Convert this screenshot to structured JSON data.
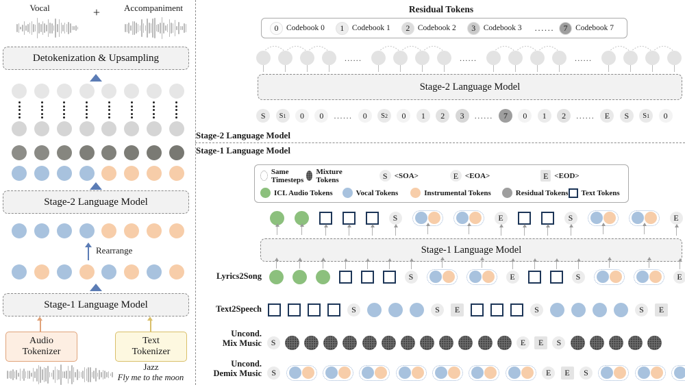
{
  "figure": {
    "left_panel": {
      "top_labels": {
        "vocal": "Vocal",
        "plus": "+",
        "accompaniment": "Accompaniment"
      },
      "detokenization_box": "Detokenization & Upsampling",
      "stage2_box": "Stage-2 Language Model",
      "rearrange_label": "Rearrange",
      "stage1_box": "Stage-1 Language Model",
      "audio_tokenizer": "Audio\nTokenizer",
      "audio_tokenizer_l1": "Audio",
      "audio_tokenizer_l2": "Tokenizer",
      "text_tokenizer_l1": "Text",
      "text_tokenizer_l2": "Tokenizer",
      "text_prompt_genre": "Jazz",
      "text_prompt_lyrics": "Fly me to the moon",
      "token_grid_columns": 8,
      "bottom_row_colors": [
        "vocal",
        "vocal",
        "vocal",
        "vocal",
        "inst",
        "inst",
        "inst",
        "inst"
      ],
      "rearrange_in_colors": [
        "vocal",
        "inst",
        "vocal",
        "inst",
        "vocal",
        "inst",
        "vocal",
        "inst"
      ],
      "rearrange_out_colors": [
        "vocal",
        "vocal",
        "vocal",
        "vocal",
        "inst",
        "inst",
        "inst",
        "inst"
      ]
    },
    "right_panel": {
      "residual_title": "Residual Tokens",
      "codebooks": [
        {
          "id": "0",
          "label": "Codebook 0",
          "shade": "#fbfbfb"
        },
        {
          "id": "1",
          "label": "Codebook 1",
          "shade": "#ededed"
        },
        {
          "id": "2",
          "label": "Codebook 2",
          "shade": "#dcdcdc"
        },
        {
          "id": "3",
          "label": "Codebook 3",
          "shade": "#cacaca"
        },
        {
          "id": "7",
          "label": "Codebook 7",
          "shade": "#9e9e9e"
        }
      ],
      "codebook_ellipsis": "......",
      "stage2_model_box": "Stage-2 Language Model",
      "stage2_input_tokens": [
        {
          "t": "S",
          "k": "sym"
        },
        {
          "t": "S₁",
          "k": "sym"
        },
        {
          "t": "0",
          "k": "cb0"
        },
        {
          "t": "0",
          "k": "cb0"
        },
        {
          "t": "......",
          "k": "dots"
        },
        {
          "t": "0",
          "k": "cb0"
        },
        {
          "t": "S₂",
          "k": "sym"
        },
        {
          "t": "0",
          "k": "cb0"
        },
        {
          "t": "1",
          "k": "cb1"
        },
        {
          "t": "2",
          "k": "cb2"
        },
        {
          "t": "3",
          "k": "cb3"
        },
        {
          "t": "......",
          "k": "dots"
        },
        {
          "t": "7",
          "k": "cb7"
        },
        {
          "t": "0",
          "k": "cb0"
        },
        {
          "t": "1",
          "k": "cb1"
        },
        {
          "t": "2",
          "k": "cb2"
        },
        {
          "t": "......",
          "k": "dots"
        },
        {
          "t": "E",
          "k": "sym"
        },
        {
          "t": "S",
          "k": "sym"
        },
        {
          "t": "S₁",
          "k": "sym"
        },
        {
          "t": "0",
          "k": "cb0"
        }
      ],
      "section_label_stage2": "Stage-2 Language Model",
      "section_label_stage1": "Stage-1 Language Model",
      "legend_row1": [
        {
          "name": "same-timesteps",
          "label": "Same Timesteps",
          "glyph": "dotted-circle"
        },
        {
          "name": "mixture-tokens",
          "label": "Mixture Tokens",
          "glyph": "textured-circle"
        },
        {
          "name": "soa",
          "label": "<SOA>",
          "glyph": "S"
        },
        {
          "name": "eoa",
          "label": "<EOA>",
          "glyph": "E-circle"
        },
        {
          "name": "eod",
          "label": "<EOD>",
          "glyph": "E-square"
        }
      ],
      "legend_row2": [
        {
          "name": "icl-audio-tokens",
          "label": "ICL Audio Tokens",
          "color": "#8cc07d"
        },
        {
          "name": "vocal-tokens",
          "label": "Vocal Tokens",
          "color": "#a8c2de"
        },
        {
          "name": "instrumental-tokens",
          "label": "Instrumental Tokens",
          "color": "#f7cda9"
        },
        {
          "name": "residual-tokens",
          "label": "Residual Tokens",
          "color": "#9e9e9e"
        },
        {
          "name": "text-tokens",
          "label": "Text Tokens",
          "color": "#ffffff"
        }
      ],
      "stage1_model_box": "Stage-1 Language Model",
      "stage1_output_tokens": [
        {
          "k": "icl"
        },
        {
          "k": "icl"
        },
        {
          "k": "text"
        },
        {
          "k": "text"
        },
        {
          "k": "text"
        },
        {
          "k": "S"
        },
        {
          "k": "pair"
        },
        {
          "k": "pair"
        },
        {
          "k": "E"
        },
        {
          "k": "text"
        },
        {
          "k": "text"
        },
        {
          "k": "S"
        },
        {
          "k": "pair"
        },
        {
          "k": "pair"
        },
        {
          "k": "E"
        },
        {
          "k": "EOD"
        }
      ],
      "rows": [
        {
          "name": "lyrics2song",
          "label": "Lyrics2Song",
          "tokens": [
            {
              "k": "icl"
            },
            {
              "k": "icl"
            },
            {
              "k": "icl"
            },
            {
              "k": "text"
            },
            {
              "k": "text"
            },
            {
              "k": "text"
            },
            {
              "k": "S"
            },
            {
              "k": "pair"
            },
            {
              "k": "pair"
            },
            {
              "k": "E"
            },
            {
              "k": "text"
            },
            {
              "k": "text"
            },
            {
              "k": "S"
            },
            {
              "k": "pair"
            },
            {
              "k": "pair"
            },
            {
              "k": "E"
            },
            {
              "k": "EOD"
            }
          ]
        },
        {
          "name": "text2speech",
          "label": "Text2Speech",
          "tokens": [
            {
              "k": "text"
            },
            {
              "k": "text"
            },
            {
              "k": "text"
            },
            {
              "k": "text"
            },
            {
              "k": "S"
            },
            {
              "k": "vocal"
            },
            {
              "k": "vocal"
            },
            {
              "k": "vocal"
            },
            {
              "k": "S"
            },
            {
              "k": "EOD"
            },
            {
              "k": "text"
            },
            {
              "k": "text"
            },
            {
              "k": "text"
            },
            {
              "k": "S"
            },
            {
              "k": "vocal"
            },
            {
              "k": "vocal"
            },
            {
              "k": "vocal"
            },
            {
              "k": "vocal"
            },
            {
              "k": "S"
            },
            {
              "k": "EOD"
            }
          ]
        },
        {
          "name": "uncond-mix-music",
          "label_line1": "Uncond.",
          "label_line2": "Mix Music",
          "tokens": [
            {
              "k": "S"
            },
            {
              "k": "mix"
            },
            {
              "k": "mix"
            },
            {
              "k": "mix"
            },
            {
              "k": "mix"
            },
            {
              "k": "mix"
            },
            {
              "k": "mix"
            },
            {
              "k": "mix"
            },
            {
              "k": "mix"
            },
            {
              "k": "mix"
            },
            {
              "k": "mix"
            },
            {
              "k": "mix"
            },
            {
              "k": "mix"
            },
            {
              "k": "E"
            },
            {
              "k": "EOD"
            },
            {
              "k": "S"
            },
            {
              "k": "mix"
            },
            {
              "k": "mix"
            },
            {
              "k": "mix"
            },
            {
              "k": "mix"
            },
            {
              "k": "mix"
            }
          ]
        },
        {
          "name": "uncond-demix-music",
          "label_line1": "Uncond.",
          "label_line2": "Demix Music",
          "tokens": [
            {
              "k": "S"
            },
            {
              "k": "pair"
            },
            {
              "k": "pair"
            },
            {
              "k": "pair"
            },
            {
              "k": "pair"
            },
            {
              "k": "pair"
            },
            {
              "k": "pair"
            },
            {
              "k": "pair"
            },
            {
              "k": "E"
            },
            {
              "k": "EOD"
            },
            {
              "k": "S"
            },
            {
              "k": "pair"
            },
            {
              "k": "pair"
            },
            {
              "k": "pair"
            }
          ]
        }
      ]
    },
    "colors": {
      "vocal": "#a8c2de",
      "instrumental": "#f7cda9",
      "icl_audio": "#8cc07d",
      "residual": "#9e9e9e",
      "mixture": "#6e6e6e",
      "accent_blue": "#5b7cb5",
      "text_token_border": "#1c3557"
    }
  }
}
